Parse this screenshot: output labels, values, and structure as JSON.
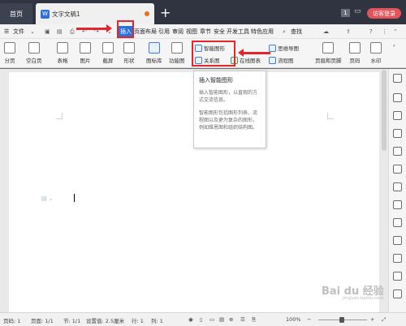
{
  "titlebar": {
    "home_tab": "首页",
    "doc_logo": "W",
    "doc_tab": "文字文稿1",
    "badge": "1",
    "login_button": "访客登录"
  },
  "menubar": {
    "file_label": "文件",
    "items": [
      "插入",
      "页面布局",
      "引用",
      "审阅",
      "视图",
      "章节",
      "安全",
      "开发工具",
      "特色应用"
    ],
    "search_label": "查找"
  },
  "ribbon": {
    "buttons": [
      "分页",
      "空白页",
      "表格",
      "图片",
      "截屏",
      "形状",
      "图标库",
      "功能图"
    ],
    "smart_art": "智能图形",
    "relation_chart": "关系图",
    "online_chart": "在线图表",
    "mind_map": "思维导图",
    "flow_chart": "流程图",
    "right_buttons": [
      "页眉和页脚",
      "页码",
      "水印"
    ]
  },
  "tooltip": {
    "title": "插入智能图形",
    "paragraph1": "插入智能图形，以直观的方式交流信息。",
    "paragraph2": "智能图形包括图形列表、流程图以及更为复杂的图形，例如维恩图和组织结构图。"
  },
  "statusbar": {
    "page_num": "页码: 1",
    "pages": "页面: 1/1",
    "section": "节: 1/1",
    "setting": "设置值: 2.5厘米",
    "row": "行: 1",
    "col": "列: 1",
    "zoom": "100%"
  },
  "watermark": {
    "text": "Bai du 经验",
    "sub": "jingyan.baidu.com"
  },
  "colors": {
    "accent": "#2a74d9",
    "highlight": "#e3262c",
    "login": "#e1545c"
  }
}
